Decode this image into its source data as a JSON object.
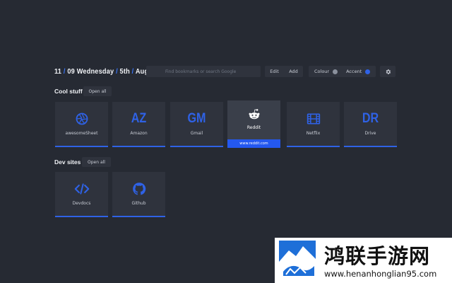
{
  "header": {
    "hour": "11",
    "date_sep1": "/",
    "minute": "09",
    "weekday": "Wednesday",
    "date_sep2": "/",
    "day": "5th",
    "date_sep3": "/",
    "month": "August",
    "search_placeholder": "Find bookmarks or search Google",
    "edit_label": "Edit",
    "add_label": "Add",
    "colour_label": "Colour",
    "accent_label": "Accent",
    "colour_toggle": "off",
    "accent_toggle": "on",
    "settings_icon": "gear-icon"
  },
  "colors": {
    "background": "#262a33",
    "tile": "#2f333d",
    "accent": "#2f62e6",
    "highlight": "#2458f0"
  },
  "groups": [
    {
      "title": "Cool stuff",
      "open_all_label": "Open all",
      "bookmarks": [
        {
          "label": "awesomeSheet",
          "icon": "aperture-icon"
        },
        {
          "label": "Amazon",
          "letters": "AZ"
        },
        {
          "label": "Gmail",
          "letters": "GM"
        },
        {
          "label": "Reddit",
          "icon": "reddit-icon",
          "url": "www.reddit.com",
          "hovered": true
        },
        {
          "label": "Netflix",
          "icon": "film-icon"
        },
        {
          "label": "Drive",
          "letters": "DR"
        }
      ]
    },
    {
      "title": "Dev sites",
      "open_all_label": "Open all",
      "bookmarks": [
        {
          "label": "Devdocs",
          "icon": "code-icon"
        },
        {
          "label": "Github",
          "icon": "github-icon"
        }
      ]
    }
  ],
  "watermark": {
    "title": "鸿联手游网",
    "url": "www.henanhonglian95.com"
  }
}
